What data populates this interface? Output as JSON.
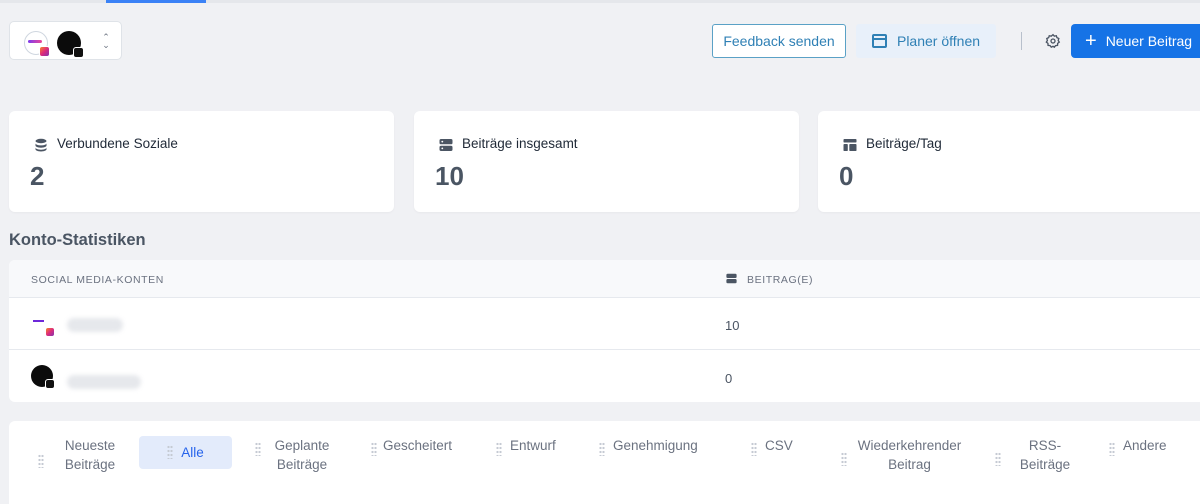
{
  "header": {
    "feedback_label": "Feedback senden",
    "planer_label": "Planer öffnen",
    "new_post_label": "Neuer Beitrag",
    "accent_color": "#1673e6"
  },
  "stats": [
    {
      "label": "Verbundene Soziale",
      "value": "2",
      "icon": "database-icon"
    },
    {
      "label": "Beiträge insgesamt",
      "value": "10",
      "icon": "server-icon"
    },
    {
      "label": "Beiträge/Tag",
      "value": "0",
      "icon": "layout-icon"
    }
  ],
  "account_stats": {
    "title": "Konto-Statistiken",
    "columns": [
      "SOCIAL MEDIA-KONTEN",
      "BEITRAG(E)"
    ],
    "rows": [
      {
        "posts": "10"
      },
      {
        "posts": "0"
      }
    ]
  },
  "tabs": [
    {
      "label": "Neueste Beiträge"
    },
    {
      "label": "Alle"
    },
    {
      "label": "Geplante Beiträge"
    },
    {
      "label": "Gescheitert"
    },
    {
      "label": "Entwurf"
    },
    {
      "label": "Genehmigung"
    },
    {
      "label": "CSV"
    },
    {
      "label": "Wiederkehrender Beitrag"
    },
    {
      "label": "RSS-Beiträge"
    },
    {
      "label": "Andere"
    }
  ]
}
